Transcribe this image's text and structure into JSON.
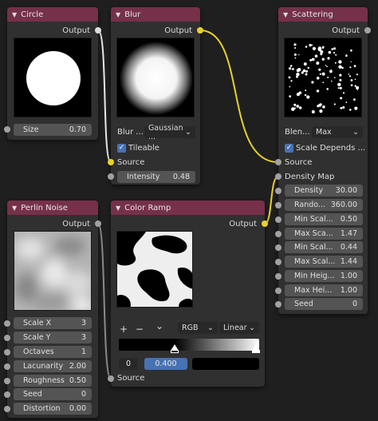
{
  "nodes": {
    "circle": {
      "title": "Circle",
      "output": "Output",
      "size_label": "Size",
      "size_value": "0.70"
    },
    "blur": {
      "title": "Blur",
      "output": "Output",
      "blur_type_label": "Blur ...",
      "blur_type_value": "Gaussian ...",
      "tileable_label": "Tileable",
      "source_label": "Source",
      "intensity_label": "Intensity",
      "intensity_value": "0.48"
    },
    "scattering": {
      "title": "Scattering",
      "output": "Output",
      "blend_label": "Blen...",
      "blend_value": "Max",
      "scale_depends_label": "Scale Depends ...",
      "source_label": "Source",
      "density_map_label": "Density Map",
      "fields": [
        {
          "label": "Density",
          "value": "30.00"
        },
        {
          "label": "Rando...",
          "value": "360.00"
        },
        {
          "label": "Min Scal...",
          "value": "0.50"
        },
        {
          "label": "Max Sca...",
          "value": "1.47"
        },
        {
          "label": "Min Scal...",
          "value": "0.44"
        },
        {
          "label": "Max Scal...",
          "value": "1.44"
        },
        {
          "label": "Min Heig...",
          "value": "1.00"
        },
        {
          "label": "Max Hei...",
          "value": "1.00"
        },
        {
          "label": "Seed",
          "value": "0"
        }
      ]
    },
    "perlin": {
      "title": "Perlin Noise",
      "output": "Output",
      "fields": [
        {
          "label": "Scale X",
          "value": "3"
        },
        {
          "label": "Scale Y",
          "value": "3"
        },
        {
          "label": "Octaves",
          "value": "1"
        },
        {
          "label": "Lacunarity",
          "value": "2.00"
        },
        {
          "label": "Roughness",
          "value": "0.50"
        },
        {
          "label": "Seed",
          "value": "0"
        },
        {
          "label": "Distortion",
          "value": "0.00"
        }
      ]
    },
    "color_ramp": {
      "title": "Color Ramp",
      "output": "Output",
      "add_symbol": "+",
      "remove_symbol": "−",
      "menu_symbol": "⌄",
      "color_mode": "RGB",
      "interpolation": "Linear",
      "stop_index": "0",
      "stop_position": "0.400",
      "source_label": "Source"
    }
  },
  "colors": {
    "header": "#76304a",
    "node_bg": "#303030",
    "field_bg": "#545454",
    "socket_gray": "#a1a1a1",
    "socket_yellow": "#e8d12b",
    "link_yellow": "#e8d12b",
    "link_gray": "#8a8a8a",
    "accent_blue": "#4772b3"
  },
  "icons": {
    "collapse": "chevron-down-icon",
    "checkbox": "check-icon"
  }
}
